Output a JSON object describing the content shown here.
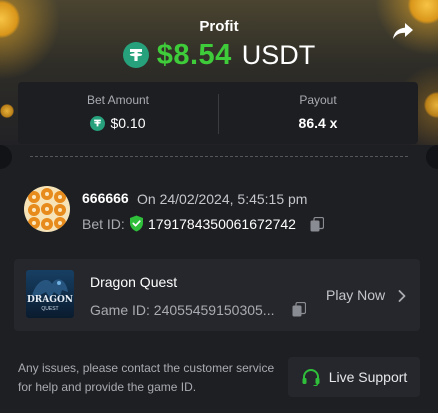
{
  "profit": {
    "label": "Profit",
    "amount": "$8.54",
    "currency": "USDT"
  },
  "stats": {
    "bet_amount_label": "Bet Amount",
    "bet_amount_value": "$0.10",
    "payout_label": "Payout",
    "payout_value": "86.4 x"
  },
  "bet": {
    "username": "666666",
    "datetime": "On 24/02/2024, 5:45:15 pm",
    "bet_id_label": "Bet ID:",
    "bet_id": "1791784350061672742"
  },
  "game": {
    "name": "Dragon Quest",
    "thumb_title": "DRAGON",
    "thumb_subtitle": "QUEST",
    "game_id": "Game ID: 24055459150305...",
    "play_now": "Play Now"
  },
  "footer": {
    "note": "Any issues, please contact the customer service for help and provide the game ID.",
    "live_support": "Live Support"
  },
  "colors": {
    "accent_green": "#3fcc3a",
    "tether_green": "#26a17b",
    "background": "#1e1f23",
    "panel": "#26272c"
  },
  "icons": [
    "tether-icon",
    "share-icon",
    "shield-check-icon",
    "copy-icon",
    "chevron-right-icon",
    "headset-icon"
  ]
}
